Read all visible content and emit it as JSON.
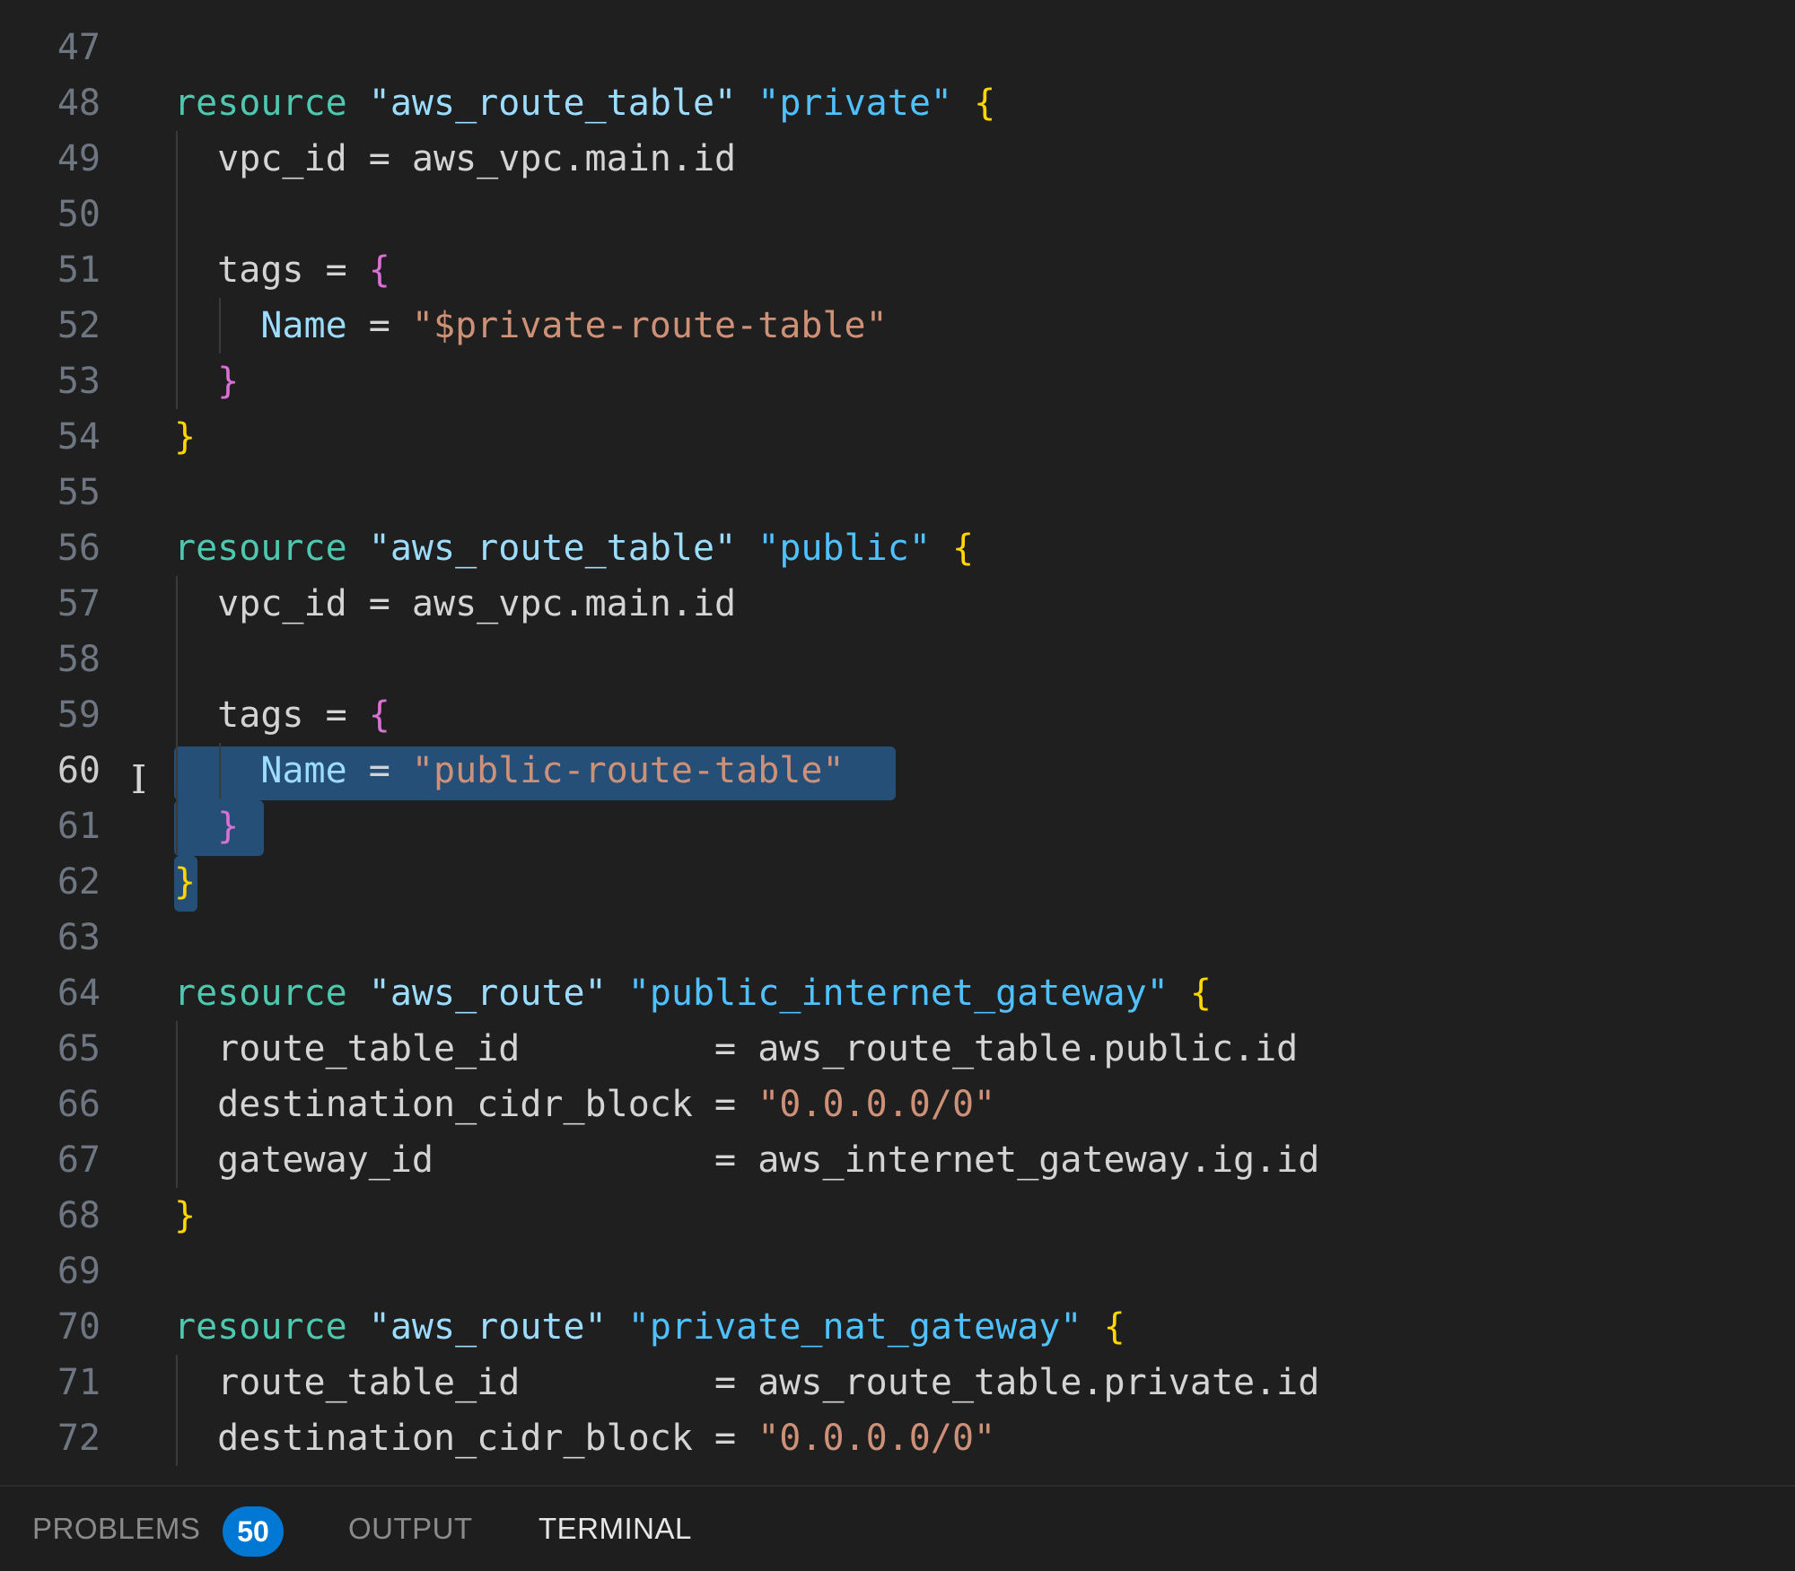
{
  "editor": {
    "lines": [
      {
        "n": "47",
        "parts": []
      },
      {
        "n": "48",
        "parts": [
          [
            "kw",
            "resource"
          ],
          [
            "id",
            " "
          ],
          [
            "ty",
            "\"aws_route_table\""
          ],
          [
            "id",
            " "
          ],
          [
            "lb",
            "\"private\""
          ],
          [
            "id",
            " "
          ],
          [
            "br1",
            "{"
          ]
        ]
      },
      {
        "n": "49",
        "parts": [
          [
            "id",
            "  vpc_id = aws_vpc.main.id"
          ]
        ]
      },
      {
        "n": "50",
        "parts": []
      },
      {
        "n": "51",
        "parts": [
          [
            "id",
            "  tags = "
          ],
          [
            "br2",
            "{"
          ]
        ]
      },
      {
        "n": "52",
        "parts": [
          [
            "id",
            "    "
          ],
          [
            "ty",
            "Name"
          ],
          [
            "id",
            " = "
          ],
          [
            "str",
            "\"$private-route-table\""
          ]
        ]
      },
      {
        "n": "53",
        "parts": [
          [
            "id",
            "  "
          ],
          [
            "br2",
            "}"
          ]
        ]
      },
      {
        "n": "54",
        "parts": [
          [
            "br1",
            "}"
          ]
        ]
      },
      {
        "n": "55",
        "parts": []
      },
      {
        "n": "56",
        "parts": [
          [
            "kw",
            "resource"
          ],
          [
            "id",
            " "
          ],
          [
            "ty",
            "\"aws_route_table\""
          ],
          [
            "id",
            " "
          ],
          [
            "lb",
            "\"public\""
          ],
          [
            "id",
            " "
          ],
          [
            "br1",
            "{"
          ]
        ]
      },
      {
        "n": "57",
        "parts": [
          [
            "id",
            "  vpc_id = aws_vpc.main.id"
          ]
        ]
      },
      {
        "n": "58",
        "parts": []
      },
      {
        "n": "59",
        "parts": [
          [
            "id",
            "  tags = "
          ],
          [
            "br2",
            "{"
          ]
        ]
      },
      {
        "n": "60",
        "parts": [
          [
            "id",
            "    "
          ],
          [
            "ty",
            "Name"
          ],
          [
            "id",
            " = "
          ],
          [
            "str",
            "\"public-route-table\""
          ]
        ],
        "active": true
      },
      {
        "n": "61",
        "parts": [
          [
            "id",
            "  "
          ],
          [
            "br2",
            "}"
          ]
        ]
      },
      {
        "n": "62",
        "parts": [
          [
            "br1",
            "}"
          ]
        ]
      },
      {
        "n": "63",
        "parts": []
      },
      {
        "n": "64",
        "parts": [
          [
            "kw",
            "resource"
          ],
          [
            "id",
            " "
          ],
          [
            "ty",
            "\"aws_route\""
          ],
          [
            "id",
            " "
          ],
          [
            "lb",
            "\"public_internet_gateway\""
          ],
          [
            "id",
            " "
          ],
          [
            "br1",
            "{"
          ]
        ]
      },
      {
        "n": "65",
        "parts": [
          [
            "id",
            "  route_table_id         = aws_route_table.public.id"
          ]
        ]
      },
      {
        "n": "66",
        "parts": [
          [
            "id",
            "  destination_cidr_block = "
          ],
          [
            "str",
            "\"0.0.0.0/0\""
          ]
        ]
      },
      {
        "n": "67",
        "parts": [
          [
            "id",
            "  gateway_id             = aws_internet_gateway.ig.id"
          ]
        ]
      },
      {
        "n": "68",
        "parts": [
          [
            "br1",
            "}"
          ]
        ]
      },
      {
        "n": "69",
        "parts": []
      },
      {
        "n": "70",
        "parts": [
          [
            "kw",
            "resource"
          ],
          [
            "id",
            " "
          ],
          [
            "ty",
            "\"aws_route\""
          ],
          [
            "id",
            " "
          ],
          [
            "lb",
            "\"private_nat_gateway\""
          ],
          [
            "id",
            " "
          ],
          [
            "br1",
            "{"
          ]
        ]
      },
      {
        "n": "71",
        "parts": [
          [
            "id",
            "  route_table_id         = aws_route_table.private.id"
          ]
        ]
      },
      {
        "n": "72",
        "parts": [
          [
            "id",
            "  destination_cidr_block = "
          ],
          [
            "str",
            "\"0.0.0.0/0\""
          ]
        ]
      }
    ]
  },
  "panel": {
    "problems_label": "PROBLEMS",
    "problems_count": "50",
    "output_label": "OUTPUT",
    "terminal_label": "TERMINAL"
  },
  "colors": {
    "editor_background": "#1f1f1f",
    "selection": "#264f78",
    "badge": "#0078d4"
  }
}
